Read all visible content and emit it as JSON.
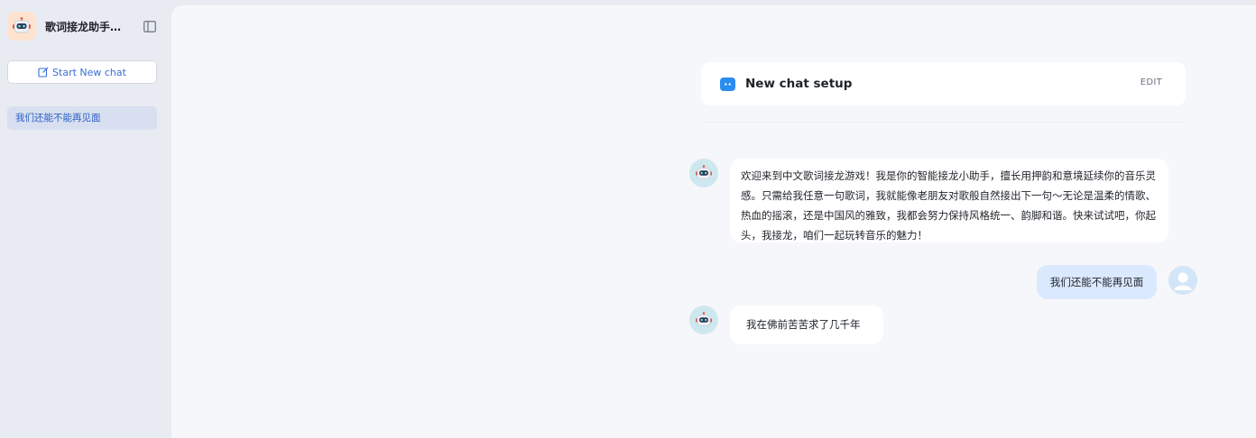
{
  "app": {
    "title": "歌词接龙助手智...",
    "collapse_icon": "sidebar-toggle-icon",
    "avatar_icon": "robot-icon",
    "accent_color": "#2a8cf0"
  },
  "sidebar": {
    "new_chat_label": "Start New chat",
    "conversations": [
      {
        "label": "我们还能不能再见面",
        "active": true
      }
    ]
  },
  "setup": {
    "title": "New chat setup",
    "edit_label": "EDIT"
  },
  "messages": [
    {
      "role": "bot",
      "text": "欢迎来到中文歌词接龙游戏！我是你的智能接龙小助手，擅长用押韵和意境延续你的音乐灵感。只需给我任意一句歌词，我就能像老朋友对歌般自然接出下一句～无论是温柔的情歌、热血的摇滚，还是中国风的雅致，我都会努力保持风格统一、韵脚和谐。快来试试吧，你起头，我接龙，咱们一起玩转音乐的魅力！"
    },
    {
      "role": "user",
      "text": "我们还能不能再见面"
    },
    {
      "role": "bot",
      "text": "我在佛前苦苦求了几千年"
    }
  ]
}
